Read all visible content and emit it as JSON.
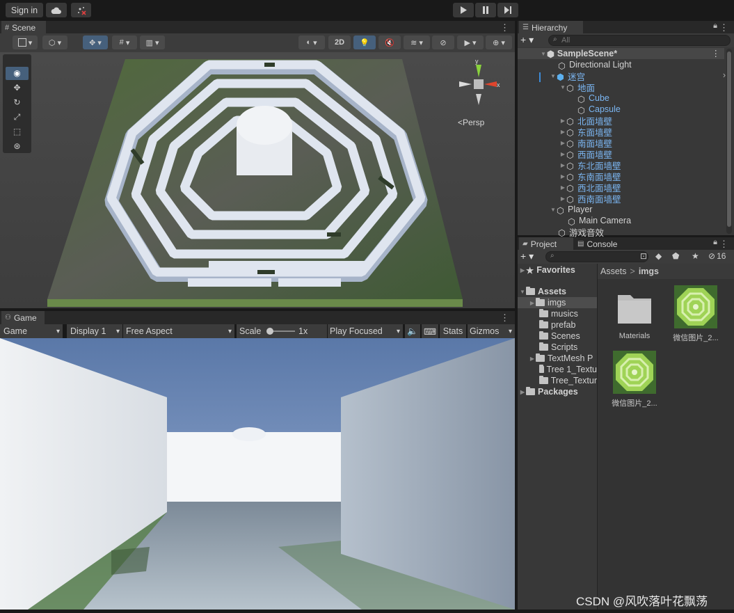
{
  "toolbar": {
    "sign_in": "Sign in",
    "cloud_icon": "cloud-icon",
    "collab_icon": "collab-icon",
    "play_icon": "play-icon",
    "pause_icon": "pause-icon",
    "step_icon": "step-icon"
  },
  "scene": {
    "tab": "Scene",
    "btn_2d": "2D",
    "persp": "<Persp",
    "gizmo_y": "y",
    "gizmo_x": "x"
  },
  "game": {
    "tab": "Game",
    "mode": "Game",
    "display": "Display 1",
    "aspect": "Free Aspect",
    "scale_label": "Scale",
    "scale_value": "1x",
    "play_mode": "Play Focused",
    "stats": "Stats",
    "gizmos": "Gizmos"
  },
  "hierarchy": {
    "tab": "Hierarchy",
    "search_placeholder": "All",
    "scene_name": "SampleScene*",
    "items": [
      {
        "label": "Directional Light"
      },
      {
        "label": "迷宫"
      },
      {
        "label": "地面"
      },
      {
        "label": "Cube"
      },
      {
        "label": "Capsule"
      },
      {
        "label": "北面墙壁"
      },
      {
        "label": "东面墙壁"
      },
      {
        "label": "南面墙壁"
      },
      {
        "label": "西面墙壁"
      },
      {
        "label": "东北面墙壁"
      },
      {
        "label": "东南面墙壁"
      },
      {
        "label": "西北面墙壁"
      },
      {
        "label": "西南面墙壁"
      },
      {
        "label": "Player"
      },
      {
        "label": "Main Camera"
      },
      {
        "label": "游戏音效"
      }
    ]
  },
  "project": {
    "tab_project": "Project",
    "tab_console": "Console",
    "hidden_count": "16",
    "favorites": "Favorites",
    "assets": "Assets",
    "packages": "Packages",
    "folders": [
      "imgs",
      "musics",
      "prefab",
      "Scenes",
      "Scripts",
      "TextMesh P",
      "Tree 1_Textu",
      "Tree_Textur"
    ],
    "breadcrumb_root": "Assets",
    "breadcrumb_sep": ">",
    "breadcrumb_current": "imgs",
    "assets_grid": [
      {
        "label": "Materials"
      },
      {
        "label": "微信图片_2..."
      },
      {
        "label": "微信图片_2..."
      }
    ]
  },
  "watermark": "CSDN @风吹落叶花飘荡"
}
